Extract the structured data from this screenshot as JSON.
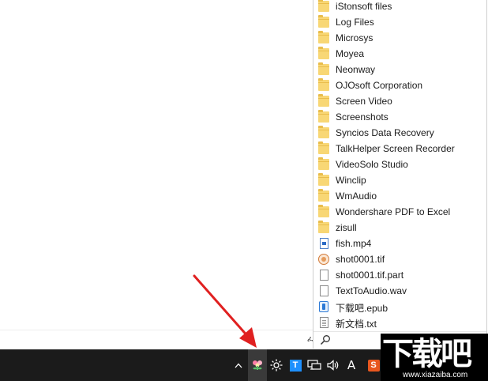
{
  "popup_menu": {
    "items": [
      {
        "label": "iStonsoft files",
        "icon": "folder-icon"
      },
      {
        "label": "Log Files",
        "icon": "folder-icon"
      },
      {
        "label": "Microsys",
        "icon": "folder-icon"
      },
      {
        "label": "Moyea",
        "icon": "folder-icon"
      },
      {
        "label": "Neonway",
        "icon": "folder-icon"
      },
      {
        "label": "OJOsoft Corporation",
        "icon": "folder-icon"
      },
      {
        "label": "Screen Video",
        "icon": "folder-icon"
      },
      {
        "label": "Screenshots",
        "icon": "folder-icon"
      },
      {
        "label": "Syncios Data Recovery",
        "icon": "folder-icon"
      },
      {
        "label": "TalkHelper Screen Recorder",
        "icon": "folder-icon"
      },
      {
        "label": "VideoSolo Studio",
        "icon": "folder-icon"
      },
      {
        "label": "Winclip",
        "icon": "folder-icon"
      },
      {
        "label": "WmAudio",
        "icon": "folder-icon"
      },
      {
        "label": "Wondershare PDF to Excel",
        "icon": "folder-icon"
      },
      {
        "label": "zisull",
        "icon": "folder-icon"
      },
      {
        "label": "fish.mp4",
        "icon": "video-file-icon"
      },
      {
        "label": "shot0001.tif",
        "icon": "image-file-icon"
      },
      {
        "label": "shot0001.tif.part",
        "icon": "blank-file-icon"
      },
      {
        "label": "TextToAudio.wav",
        "icon": "blank-file-icon"
      },
      {
        "label": "下载吧.epub",
        "icon": "epub-file-icon"
      },
      {
        "label": "新文档.txt",
        "icon": "text-file-icon"
      }
    ],
    "search_icon": "search-icon"
  },
  "taskbar": {
    "chevron": "^",
    "tray_t_label": "T",
    "ime_label": "A",
    "sogou_label": "S",
    "active_tray_icon": "app-tray-icon"
  },
  "watermark": {
    "text": "下载吧",
    "url": "www.xiazaiba.com"
  },
  "colors": {
    "taskbar_bg": "#1b1b1b",
    "folder": "#f8d775",
    "arrow": "#e02020"
  }
}
